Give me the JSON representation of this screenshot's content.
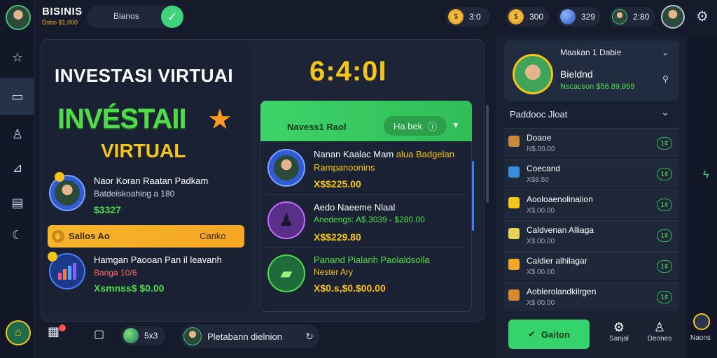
{
  "brand": {
    "title": "BISINIS",
    "subtitle": "Dsbo $1,000"
  },
  "search": {
    "label": "Bianos"
  },
  "top_stats": [
    {
      "icon": "coin-icon",
      "value": "3:0"
    },
    {
      "icon": "coin-icon",
      "value": "300"
    },
    {
      "icon": "globe-icon",
      "value": "329"
    },
    {
      "icon": "avatar-icon",
      "value": "2:80"
    }
  ],
  "main": {
    "title": "INVESTASI VIRTUAI",
    "timer": "6:4:0I",
    "hero_line1": "INVÉSTAII",
    "hero_line2": "VIRTUAL",
    "left_rows": [
      {
        "title": "Naor Koran Raatan Padkam",
        "sub": "Batdeiskoahing a 180",
        "value": "$3327"
      },
      {
        "title": "Hamgan Paooan Pan il leavanh",
        "sub": "Banga 10/6",
        "value": "Xsmnss$ $0.00"
      }
    ],
    "orange_bar": {
      "left": "Sallos Ao",
      "right": "Canko"
    }
  },
  "card": {
    "header_title": "Navess1 Raol",
    "pill_label": "Ha bek",
    "rows": [
      {
        "title": "Nanan Kaalac Mam",
        "title_accent": "alua Badgelan",
        "sub": "Rampanoonins",
        "value": "X$$225.00"
      },
      {
        "title": "Aedo Naeeme Nlaal",
        "sub": "Anedengs: A$.3039 - $280.00",
        "value": "X$$229.80"
      },
      {
        "title": "Panand Pialanh Paolaldsolla",
        "sub": "Nester Ary",
        "value": "X$0.s,$0.$00.00"
      }
    ]
  },
  "sidebar": {
    "profile": {
      "dropdown": "Maakan 1 Dabie",
      "name": "Bieldnd",
      "sub": "Nscacson $56.89,999"
    },
    "dropdown_title": "Paddooc Jloat",
    "items": [
      {
        "title": "Doaoe",
        "sub": "N$.00.00",
        "badge": "1¢",
        "color": "#c98a3a"
      },
      {
        "title": "Coecand",
        "sub": "X$8.50",
        "badge": "1¢",
        "color": "#3a8fd9"
      },
      {
        "title": "Aooloaenolinalion",
        "sub": "X$.00.00",
        "badge": "1¢",
        "color": "#f5c518"
      },
      {
        "title": "Caldvenan Alliaga",
        "sub": "X$.00.00",
        "badge": "1¢",
        "color": "#e8d35a"
      },
      {
        "title": "Caldier alhilagar",
        "sub": "X$ 00.00",
        "badge": "1¢",
        "color": "#f5a623"
      },
      {
        "title": "Aoblerolandkilrgen",
        "sub": "X$ 00.00",
        "badge": "1¢",
        "color": "#d98a2f"
      }
    ],
    "action_button": "Gaiton",
    "bottom_items": [
      {
        "label": "Sanjal"
      },
      {
        "label": "Deones"
      }
    ],
    "far_label": "Naons"
  },
  "bottom_left": {
    "globe_value": "5x3",
    "user_label": "Pletabann dielnion"
  }
}
